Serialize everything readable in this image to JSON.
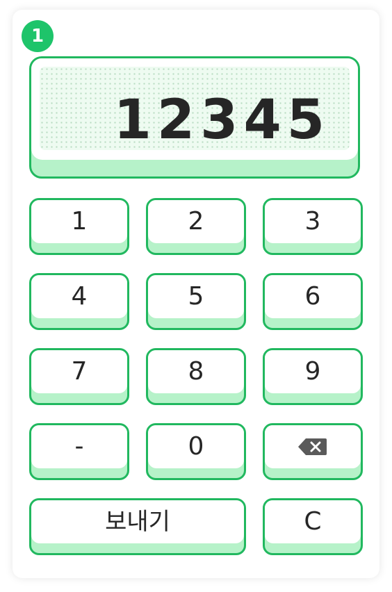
{
  "step_badge": "1",
  "display": {
    "value": "12345"
  },
  "keypad": {
    "key_1": "1",
    "key_2": "2",
    "key_3": "3",
    "key_4": "4",
    "key_5": "5",
    "key_6": "6",
    "key_7": "7",
    "key_8": "8",
    "key_9": "9",
    "key_minus": "-",
    "key_0": "0",
    "backspace_icon": "backspace-icon",
    "send": "보내기",
    "clear": "C"
  },
  "colors": {
    "accent": "#21b85f",
    "key_shadow": "#b6f2c9",
    "badge": "#1ec46a",
    "text": "#262626"
  }
}
